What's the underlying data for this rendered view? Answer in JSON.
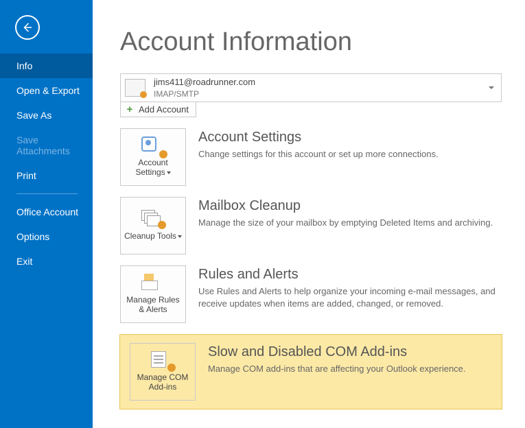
{
  "sidebar": {
    "items": [
      {
        "label": "Info",
        "active": true,
        "disabled": false
      },
      {
        "label": "Open & Export",
        "active": false,
        "disabled": false
      },
      {
        "label": "Save As",
        "active": false,
        "disabled": false
      },
      {
        "label": "Save Attachments",
        "active": false,
        "disabled": true
      },
      {
        "label": "Print",
        "active": false,
        "disabled": false
      }
    ],
    "footer_items": [
      {
        "label": "Office Account"
      },
      {
        "label": "Options"
      },
      {
        "label": "Exit"
      }
    ]
  },
  "page": {
    "title": "Account Information"
  },
  "account": {
    "email": "jims411@roadrunner.com",
    "protocol": "IMAP/SMTP",
    "add_label": "Add Account"
  },
  "sections": {
    "settings": {
      "tile": "Account Settings",
      "title": "Account Settings",
      "desc": "Change settings for this account or set up more connections."
    },
    "cleanup": {
      "tile": "Cleanup Tools",
      "title": "Mailbox Cleanup",
      "desc": "Manage the size of your mailbox by emptying Deleted Items and archiving."
    },
    "rules": {
      "tile": "Manage Rules & Alerts",
      "title": "Rules and Alerts",
      "desc": "Use Rules and Alerts to help organize your incoming e-mail messages, and receive updates when items are added, changed, or removed."
    },
    "addins": {
      "tile": "Manage COM Add-ins",
      "title": "Slow and Disabled COM Add-ins",
      "desc": "Manage COM add-ins that are affecting your Outlook experience."
    }
  }
}
